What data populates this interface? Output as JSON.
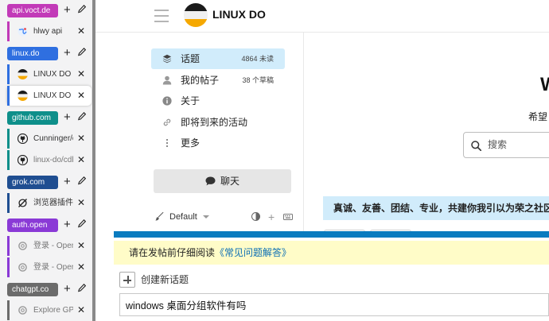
{
  "tab_groups": [
    {
      "label": "api.voct.de",
      "color": "#c23ab8",
      "tabs": [
        {
          "title": "hlwy api",
          "favicon": "globe-icon",
          "active": false,
          "dim": false
        }
      ]
    },
    {
      "label": "linux.do",
      "color": "#2f6fe0",
      "tabs": [
        {
          "title": "LINUX DO -",
          "favicon": "linux-do-icon",
          "active": false,
          "dim": false
        },
        {
          "title": "LINUX DO -",
          "favicon": "linux-do-icon",
          "active": true,
          "dim": false
        }
      ]
    },
    {
      "label": "github.com",
      "color": "#0e8f8a",
      "tabs": [
        {
          "title": "Cunninger/o",
          "favicon": "github-icon",
          "active": false,
          "dim": false
        },
        {
          "title": "linux-do/cdl",
          "favicon": "github-icon",
          "active": false,
          "dim": true
        }
      ]
    },
    {
      "label": "grok.com",
      "color": "#1f4e91",
      "tabs": [
        {
          "title": "浏览器插件",
          "favicon": "grok-icon",
          "active": false,
          "dim": false
        }
      ]
    },
    {
      "label": "auth.open",
      "color": "#8a3ad6",
      "tabs": [
        {
          "title": "登录 - Open",
          "favicon": "openai-icon",
          "active": false,
          "dim": true
        },
        {
          "title": "登录 - Open",
          "favicon": "openai-icon",
          "active": false,
          "dim": true
        }
      ]
    },
    {
      "label": "chatgpt.co",
      "color": "#6b6b6b",
      "tabs": [
        {
          "title": "Explore GPT",
          "favicon": "openai-icon",
          "active": false,
          "dim": true
        }
      ]
    }
  ],
  "header": {
    "site_name": "LINUX DO",
    "logo_colors": {
      "top": "#1b1b1b",
      "middle": "#f0f0f0",
      "bottom": "#f5a800"
    }
  },
  "sidebar": {
    "items": [
      {
        "label": "话题",
        "count": "4864 未读",
        "icon": "layers-icon",
        "selected": true
      },
      {
        "label": "我的帖子",
        "count": "38 个草稿",
        "icon": "user-icon",
        "selected": false
      },
      {
        "label": "关于",
        "count": "",
        "icon": "info-icon",
        "selected": false
      },
      {
        "label": "即将到来的活动",
        "count": "",
        "icon": "link-icon",
        "selected": false
      },
      {
        "label": "更多",
        "count": "",
        "icon": "more-vertical-icon",
        "selected": false
      }
    ],
    "chat_label": "聊天",
    "theme_label": "Default"
  },
  "main": {
    "welcome_title": "W",
    "welcome_subtitle": "希望",
    "search_placeholder": "搜索",
    "banner_text": "真诚、友善、团结、专业，共建你我引以为荣之社区"
  },
  "composer": {
    "notice_prefix": "请在发帖前仔细阅读",
    "notice_link": "《常见问题解答》",
    "new_topic_label": "创建新话题",
    "title_value": "windows 桌面分组软件有吗"
  },
  "colors": {
    "accent": "#0a7bbf",
    "selected_bg": "#d1ecfb",
    "notice_bg": "#fffcc8"
  }
}
